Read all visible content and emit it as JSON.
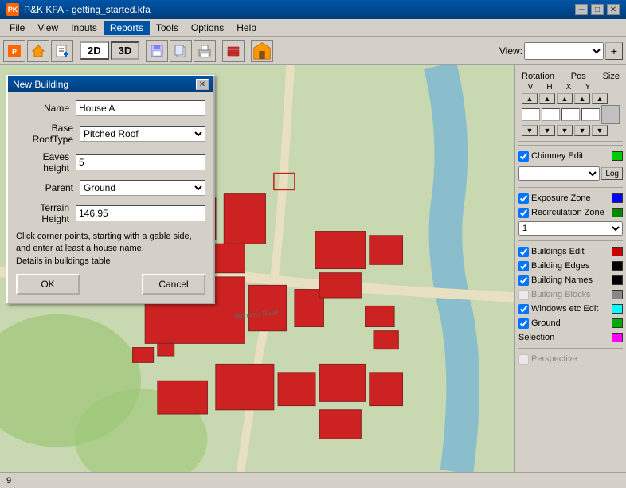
{
  "titlebar": {
    "icon": "PK",
    "title": "P&K KFA - getting_started.kfa",
    "minimize": "─",
    "maximize": "□",
    "close": "✕"
  },
  "menubar": {
    "items": [
      "File",
      "View",
      "Inputs",
      "Reports",
      "Tools",
      "Options",
      "Help"
    ]
  },
  "toolbar": {
    "mode_2d": "2D",
    "mode_3d": "3D",
    "view_label": "View:",
    "view_plus": "+"
  },
  "dialog": {
    "title": "New Building",
    "close": "✕",
    "name_label": "Name",
    "name_value": "House A",
    "rooftype_label": "Base RoofType",
    "rooftype_value": "Pitched Roof",
    "eaves_label": "Eaves height",
    "eaves_value": "5",
    "parent_label": "Parent",
    "parent_value": "Ground",
    "terrain_label": "Terrain Height",
    "terrain_value": "146.95",
    "info_text": "Click corner points, starting with a gable side, and enter at least a house name.\nDetails in buildings table",
    "ok_label": "OK",
    "cancel_label": "Cancel"
  },
  "right_panel": {
    "rotation_label": "Rotation",
    "v_label": "V",
    "h_label": "H",
    "pos_label": "Pos",
    "x_label": "X",
    "y_label": "Y",
    "size_label": "Size",
    "chimney_label": "Chimney",
    "chimney_edit": "Edit",
    "chimney_color": "#00cc00",
    "chimney_checked": true,
    "log_btn": "Log",
    "exposure_label": "Exposure Zone",
    "exposure_color": "#0000ff",
    "exposure_checked": true,
    "recirculation_label": "Recirculation Zone",
    "recirculation_color": "#00aa00",
    "recirculation_checked": true,
    "dropdown_val": "1",
    "buildings_label": "Buildings",
    "buildings_edit": "Edit",
    "buildings_color": "#cc0000",
    "buildings_checked": true,
    "building_edges_label": "Building Edges",
    "building_edges_color": "#000000",
    "building_edges_checked": true,
    "building_names_label": "Building Names",
    "building_names_color": "#000000",
    "building_names_checked": true,
    "building_blocks_label": "Building Blocks",
    "building_blocks_color": "#888888",
    "building_blocks_checked": false,
    "windows_label": "Windows etc",
    "windows_edit": "Edit",
    "windows_color": "#00ffff",
    "windows_checked": true,
    "ground_label": "Ground",
    "ground_color": "#00aa00",
    "ground_checked": true,
    "selection_label": "Selection",
    "selection_color": "#ff00ff",
    "perspective_label": "Perspective",
    "perspective_checked": false
  },
  "statusbar": {
    "value": "9"
  }
}
